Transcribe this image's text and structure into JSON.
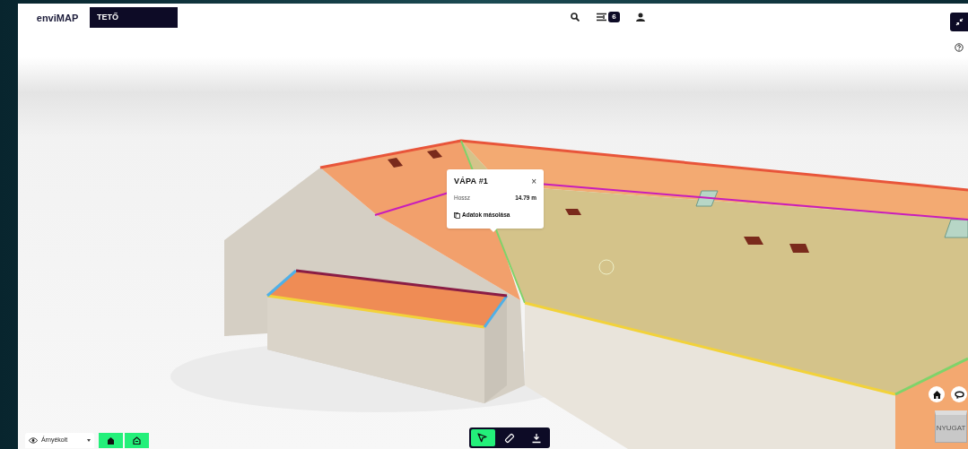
{
  "header": {
    "logo": "enviMAP",
    "project_title": "TETŐ"
  },
  "top_actions": {
    "filter_count": "6"
  },
  "popup": {
    "title": "VÁPA #1",
    "close": "×",
    "rows": [
      {
        "label": "Hossz",
        "value": "14.79 m"
      }
    ],
    "copy_action": "Adatok másolása"
  },
  "view_mode": {
    "value": "Árnyékolt"
  },
  "bottom_tools": [
    {
      "kind": "select",
      "selected": true
    },
    {
      "kind": "measure",
      "selected": false
    },
    {
      "kind": "download",
      "selected": false
    }
  ],
  "compass": {
    "label": "NYUGAT"
  }
}
